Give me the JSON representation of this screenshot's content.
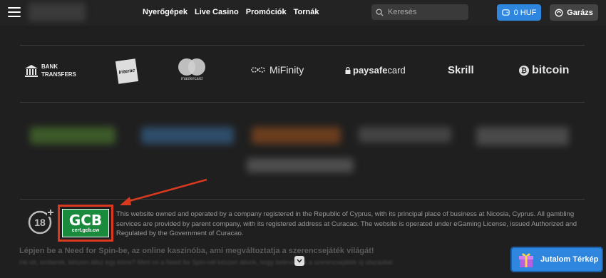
{
  "header": {
    "nav": [
      "Nyerőgépek",
      "Live Casino",
      "Promóciók",
      "Tornák"
    ],
    "search_placeholder": "Keresés",
    "wallet_label": "0 HUF",
    "garage_label": "Garázs"
  },
  "payments": {
    "bank_line1": "BANK",
    "bank_line2": "TRANSFERS",
    "interac": "Interac",
    "mastercard": "mastercard",
    "mifinity": "MiFinity",
    "paysafe_bold": "paysafe",
    "paysafe_thin": "card",
    "skrill": "Skrill",
    "bitcoin": "bitcoin"
  },
  "licence": {
    "age_badge": "18",
    "gcb_title": "GCB",
    "gcb_sub": "cert.gcb.cw",
    "text": "This website owned and operated by a company registered in the Republic of Cyprus, with its principal place of business at Nicosia, Cyprus. All gambling services are provided by parent company, with its registered address at Curacao. The website is operated under eGaming License, issued Authorized and Regulated by the Government of Curacao."
  },
  "intro": {
    "title": "Lépjen be a Need for Spin-be, az online kaszinóba, ami megváltoztatja a szerencsejáték világát!",
    "text": "Hé ott, emberek, készen állsz egy körre? Mert mi a Need for Spin-nél készen állunk, hogy belevetünk a szerencsejáték új utazásba!"
  },
  "reward_button": "Jutalom Térkép",
  "colors": {
    "accent": "#2e86de",
    "highlight": "#d93a1f",
    "gcb_green": "#1a8a3c"
  }
}
